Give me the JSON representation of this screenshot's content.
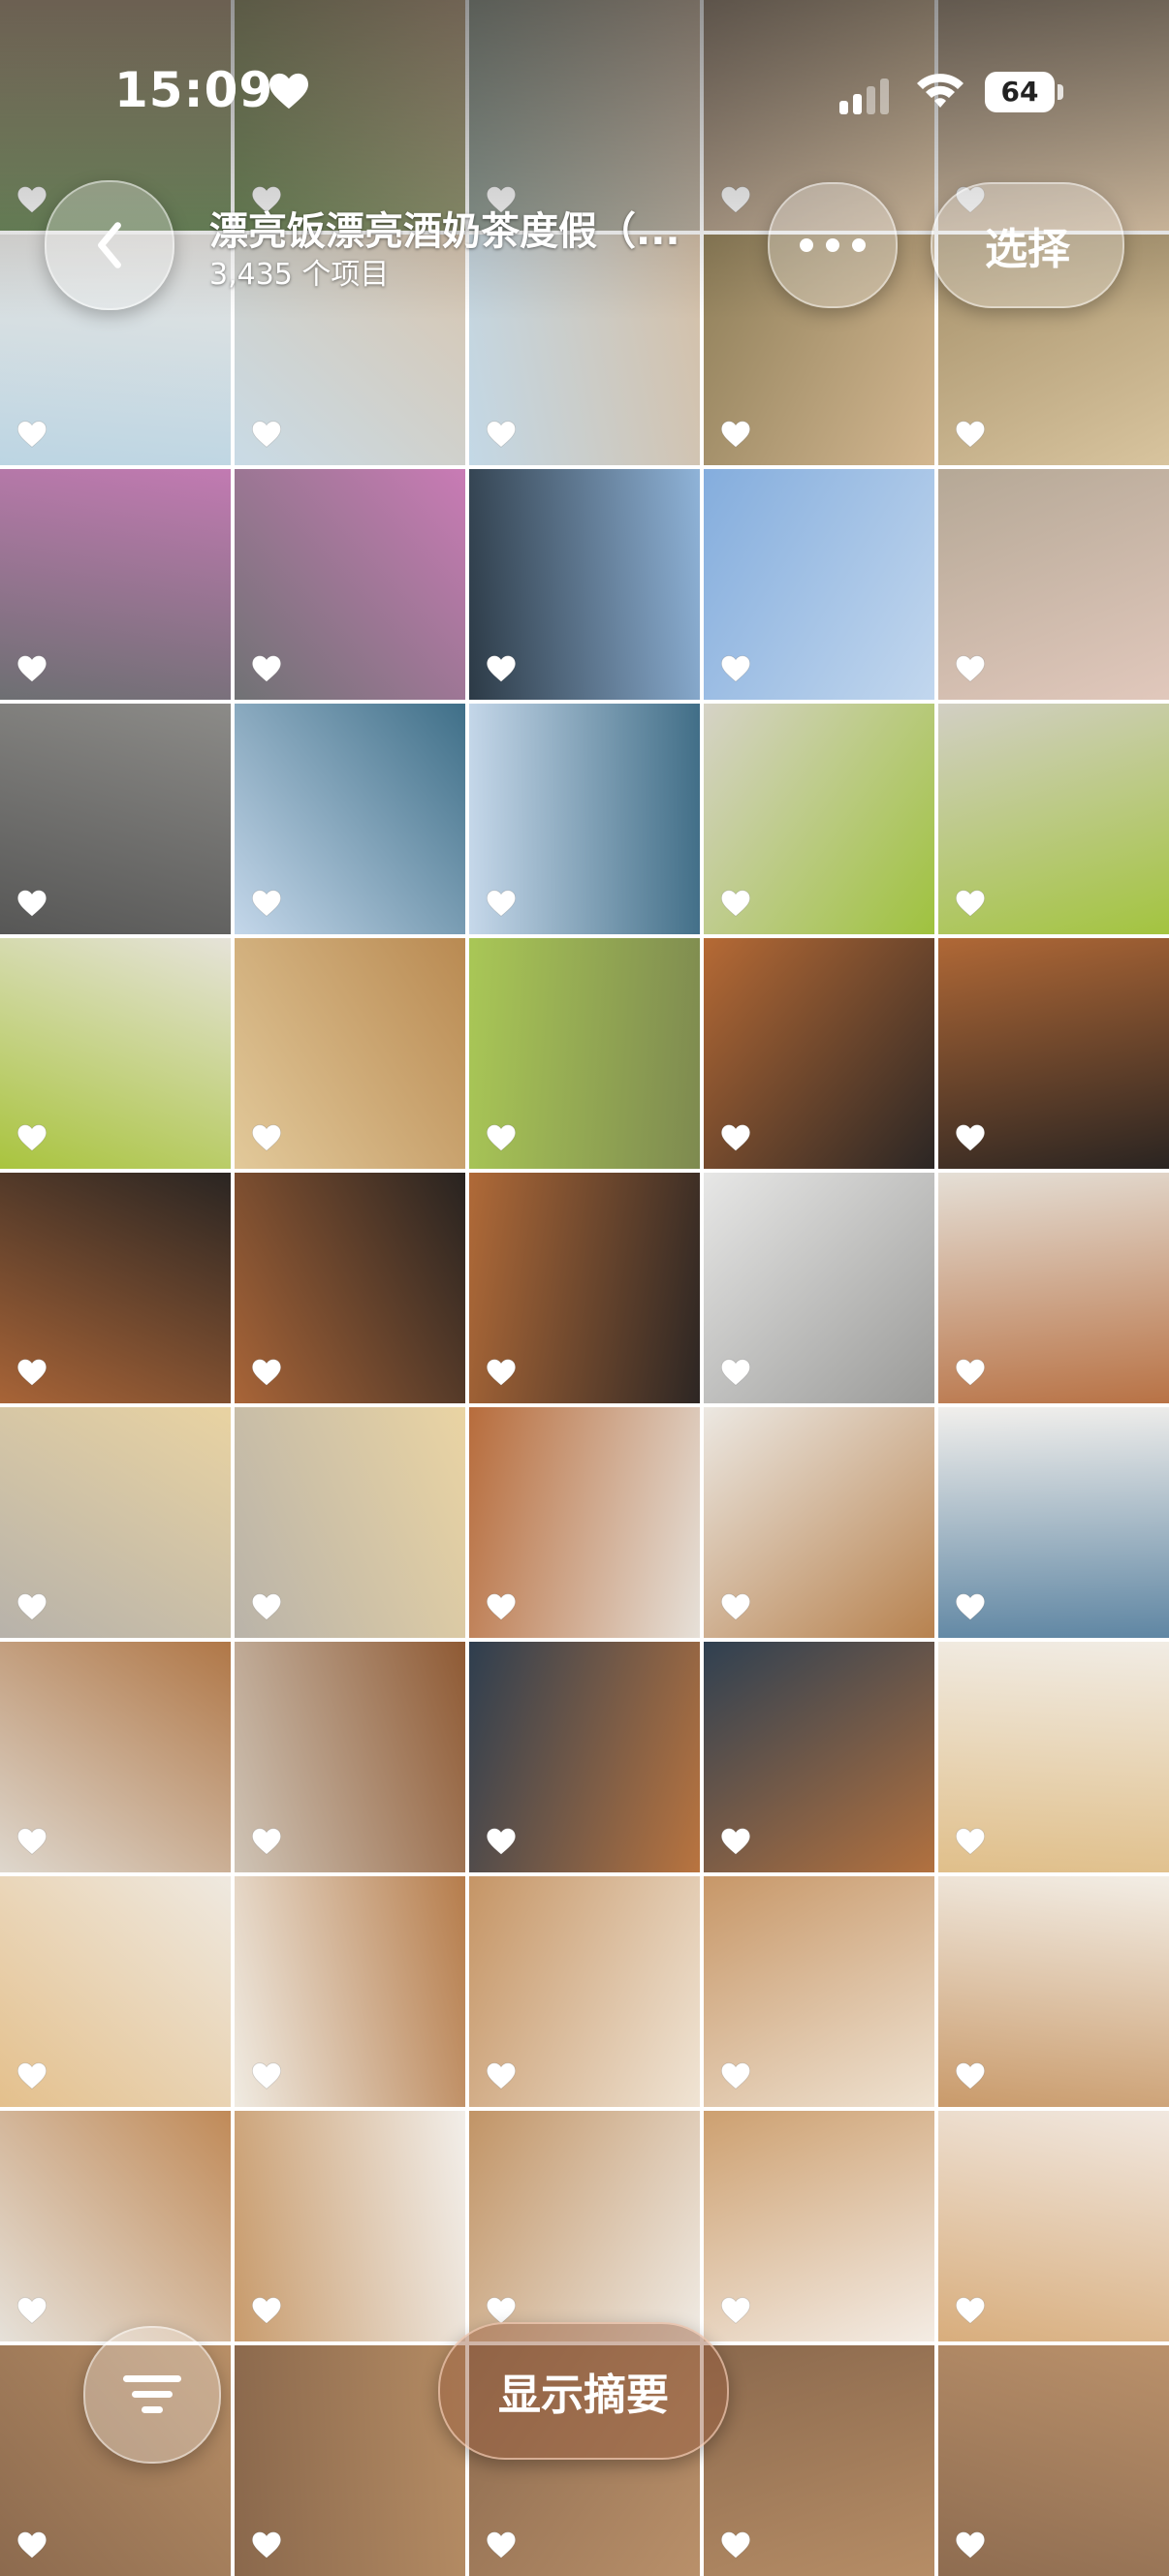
{
  "status_bar": {
    "time": "15:09",
    "battery": "64"
  },
  "header": {
    "title": "漂亮饭漂亮酒奶茶度假（...",
    "subtitle": "3,435 个项目",
    "select_label": "选择"
  },
  "bottom": {
    "summary_label": "显示摘要"
  },
  "icons": {
    "back": "chevron-left-icon",
    "more": "ellipsis-icon",
    "filter": "filter-icon",
    "favorite": "heart-icon"
  },
  "colors": {
    "accent_summary": "#9a5a3c",
    "text_on_photo": "#ffffff"
  },
  "photos": [
    {
      "subject": "grass-fence",
      "c1": "#6f8a5e",
      "c2": "#b9a58d"
    },
    {
      "subject": "grass-fence",
      "c1": "#6b8558",
      "c2": "#c2ab90"
    },
    {
      "subject": "deck-snacks",
      "c1": "#8d9a92",
      "c2": "#c9b8a6"
    },
    {
      "subject": "snacks",
      "c1": "#a09080",
      "c2": "#d9c2a4"
    },
    {
      "subject": "snacks",
      "c1": "#aa9a88",
      "c2": "#e0c9ab"
    },
    {
      "subject": "beach",
      "c1": "#bcd5e3",
      "c2": "#e9e6e2"
    },
    {
      "subject": "beach-snacks",
      "c1": "#c9dbe6",
      "c2": "#d8c6b0"
    },
    {
      "subject": "beach-snacks",
      "c1": "#c3d8e6",
      "c2": "#d4c0a8"
    },
    {
      "subject": "snack-pile",
      "c1": "#8f7f5a",
      "c2": "#d3b790"
    },
    {
      "subject": "food-boxes",
      "c1": "#a6916b",
      "c2": "#d8c49e"
    },
    {
      "subject": "mm-lid",
      "c1": "#6d6f72",
      "c2": "#c27ab2"
    },
    {
      "subject": "mm-lid",
      "c1": "#707274",
      "c2": "#c97bb5"
    },
    {
      "subject": "sky-trees",
      "c1": "#2c3a46",
      "c2": "#8fb3d8"
    },
    {
      "subject": "blue-sky",
      "c1": "#84addd",
      "c2": "#c2d7ee"
    },
    {
      "subject": "shells-hand",
      "c1": "#b5a896",
      "c2": "#e1c8bc"
    },
    {
      "subject": "sand-shells",
      "c1": "#575756",
      "c2": "#8c8b88"
    },
    {
      "subject": "sea-horizon",
      "c1": "#c4d7ea",
      "c2": "#3f6f88"
    },
    {
      "subject": "sea-boat",
      "c1": "#c6d8ea",
      "c2": "#416e87"
    },
    {
      "subject": "kiwi-plate",
      "c1": "#d6d3c7",
      "c2": "#9fc23e"
    },
    {
      "subject": "kiwi-plate",
      "c1": "#d2cfc4",
      "c2": "#a3c43f"
    },
    {
      "subject": "kiwi-slices",
      "c1": "#a9c43e",
      "c2": "#e6e3d9"
    },
    {
      "subject": "snack-pack",
      "c1": "#e2c99a",
      "c2": "#b98a52"
    },
    {
      "subject": "green-bun",
      "c1": "#a9c756",
      "c2": "#7e8a50"
    },
    {
      "subject": "pasta-bowl",
      "c1": "#b66a35",
      "c2": "#2b2624"
    },
    {
      "subject": "pasta-bowl",
      "c1": "#b06836",
      "c2": "#2a2421"
    },
    {
      "subject": "pasta-table",
      "c1": "#a86437",
      "c2": "#2a2522"
    },
    {
      "subject": "pasta-table",
      "c1": "#a96538",
      "c2": "#282320"
    },
    {
      "subject": "pasta-sandwich",
      "c1": "#b06a38",
      "c2": "#2d2623"
    },
    {
      "subject": "cafe-wall",
      "c1": "#e7e7e6",
      "c2": "#9a9a98"
    },
    {
      "subject": "cafe-counter",
      "c1": "#e5dfd6",
      "c2": "#b87245"
    },
    {
      "subject": "cake",
      "c1": "#b7b2aa",
      "c2": "#e9d3a2"
    },
    {
      "subject": "cake",
      "c1": "#b9b3a9",
      "c2": "#ead4a3"
    },
    {
      "subject": "cafe-shelf",
      "c1": "#b76c3c",
      "c2": "#e6e0d8"
    },
    {
      "subject": "cafe-interior",
      "c1": "#ece8e2",
      "c2": "#b7824f"
    },
    {
      "subject": "cafe-room",
      "c1": "#f1efec",
      "c2": "#5f86a3"
    },
    {
      "subject": "cafe-bar",
      "c1": "#ded7cd",
      "c2": "#b07747"
    },
    {
      "subject": "cafe-window",
      "c1": "#cfc4b6",
      "c2": "#8f5a34"
    },
    {
      "subject": "window-seat",
      "c1": "#2e3e4f",
      "c2": "#b9743f"
    },
    {
      "subject": "window-seat",
      "c1": "#2f4051",
      "c2": "#b2713f"
    },
    {
      "subject": "coffee-tasting",
      "c1": "#e0bf8a",
      "c2": "#f1ece4"
    },
    {
      "subject": "coffee-tasting",
      "c1": "#e4c08c",
      "c2": "#efe9e0"
    },
    {
      "subject": "menu",
      "c1": "#f0ebe2",
      "c2": "#b67d4c"
    },
    {
      "subject": "menu-cards",
      "c1": "#c59566",
      "c2": "#f0e4d4"
    },
    {
      "subject": "menu-cards",
      "c1": "#c79768",
      "c2": "#efe2d1"
    },
    {
      "subject": "menu",
      "c1": "#c99a6a",
      "c2": "#f3eee6"
    },
    {
      "subject": "cafe-interior",
      "c1": "#e6e1d9",
      "c2": "#c08a58"
    },
    {
      "subject": "coffee-cup",
      "c1": "#c89b6c",
      "c2": "#f2eee9"
    },
    {
      "subject": "coffee-cup",
      "c1": "#c19466",
      "c2": "#f0ebe4"
    },
    {
      "subject": "coffee-card",
      "c1": "#cda070",
      "c2": "#f4ece4"
    },
    {
      "subject": "coffee-card",
      "c1": "#d8ad7c",
      "c2": "#f1e8e0"
    },
    {
      "subject": "floor",
      "c1": "#8c6a4e",
      "c2": "#b88f67"
    },
    {
      "subject": "floor",
      "c1": "#8a684c",
      "c2": "#b58c64"
    },
    {
      "subject": "floor",
      "c1": "#8d6b4f",
      "c2": "#b9906a"
    },
    {
      "subject": "floor",
      "c1": "#8b694d",
      "c2": "#b68d66"
    },
    {
      "subject": "floor",
      "c1": "#8e6c50",
      "c2": "#ba916b"
    }
  ]
}
